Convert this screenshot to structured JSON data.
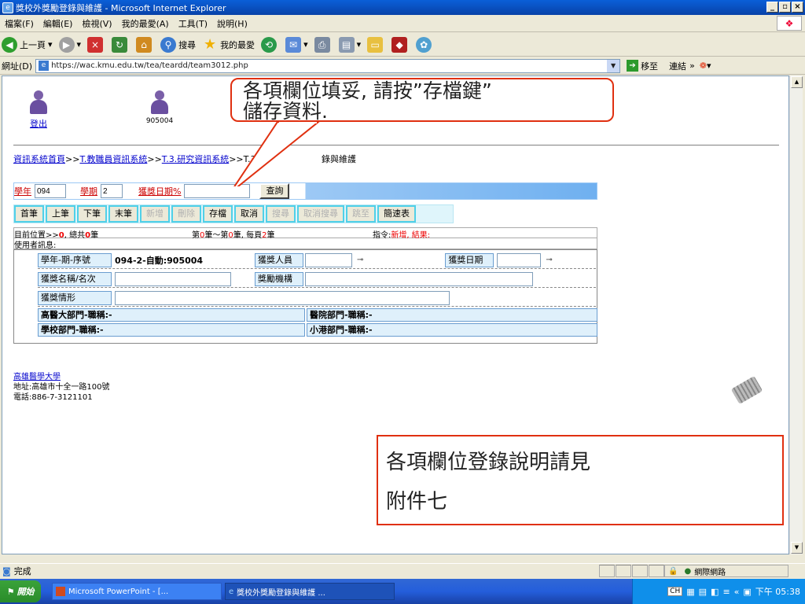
{
  "window": {
    "title": "獎校外獎勵登錄與維護 - Microsoft Internet Explorer"
  },
  "menu": [
    "檔案(F)",
    "編輯(E)",
    "檢視(V)",
    "我的最愛(A)",
    "工具(T)",
    "說明(H)"
  ],
  "toolbar": {
    "back": "上一頁",
    "search": "搜尋",
    "favorites": "我的最愛"
  },
  "address": {
    "label": "網址(D)",
    "url": "https://wac.kmu.edu.tw/tea/teardd/team3012.php",
    "go": "移至",
    "links": "連結"
  },
  "header": {
    "logout": "登出",
    "user_id": "905004"
  },
  "breadcrumb": {
    "home": "資訊系統首頁",
    "sep": ">>",
    "staff": "T.教職員資訊系統",
    "research": "T.3.研究資訊系統",
    "rest_prefix": "T.3.0",
    "rest_suffix": "錄與維護"
  },
  "query": {
    "year_label": "學年",
    "year": "094",
    "term_label": "學期",
    "term": "2",
    "date_label": "獲獎日期%",
    "date": "",
    "search_btn": "查詢"
  },
  "nav": {
    "buttons": [
      {
        "label": "首筆",
        "enabled": true
      },
      {
        "label": "上筆",
        "enabled": true
      },
      {
        "label": "下筆",
        "enabled": true
      },
      {
        "label": "末筆",
        "enabled": true
      },
      {
        "label": "新增",
        "enabled": false
      },
      {
        "label": "刪除",
        "enabled": false
      },
      {
        "label": "存檔",
        "enabled": true
      },
      {
        "label": "取消",
        "enabled": true
      },
      {
        "label": "搜尋",
        "enabled": false
      },
      {
        "label": "取消搜尋",
        "enabled": false
      },
      {
        "label": "跳至",
        "enabled": false
      },
      {
        "label": "簡速表",
        "enabled": true
      }
    ]
  },
  "status": {
    "pos_a": "目前位置>>",
    "pos_num": "0",
    "pos_b": ", 總共",
    "total": "0",
    "pos_c": "筆",
    "range_a": "第",
    "range_from": "0",
    "range_b": "筆～第",
    "range_to": "0",
    "range_c": "筆, 每頁",
    "per_page": "2",
    "range_d": "筆",
    "cmd_a": "指令:",
    "cmd": "新增, 結果:",
    "msg": "使用者訊息:"
  },
  "form": {
    "seq_label": "學年-期-序號",
    "seq_value": "094-2-自動:905004",
    "winner_label": "獲獎人員",
    "award_date_label": "獲獎日期",
    "award_name_label": "獲獎名稱/名次",
    "org_label": "獎勵機構",
    "situation_label": "獲獎情形",
    "dept1": "高醫大部門-職稱:-",
    "dept2": "醫院部門-職稱:-",
    "dept3": "學校部門-職稱:-",
    "dept4": "小港部門-職稱:-"
  },
  "footer": {
    "school": "高雄醫學大學",
    "address": "地址:高雄市十全一路100號",
    "phone": "電話:886-7-3121101"
  },
  "callouts": {
    "top_line1": "各項欄位填妥, 請按”存檔鍵”",
    "top_line2": "儲存資料.",
    "bottom_line1": "各項欄位登錄說明請見",
    "bottom_line2": "附件七"
  },
  "statusbar": {
    "text": "完成",
    "zone": "網際網路"
  },
  "taskbar": {
    "start": "開始",
    "task1": "Microsoft PowerPoint - [...",
    "task2": "獎校外獎勵登錄與維護 ...",
    "clock": "下午 05:38",
    "ime": "CH"
  }
}
